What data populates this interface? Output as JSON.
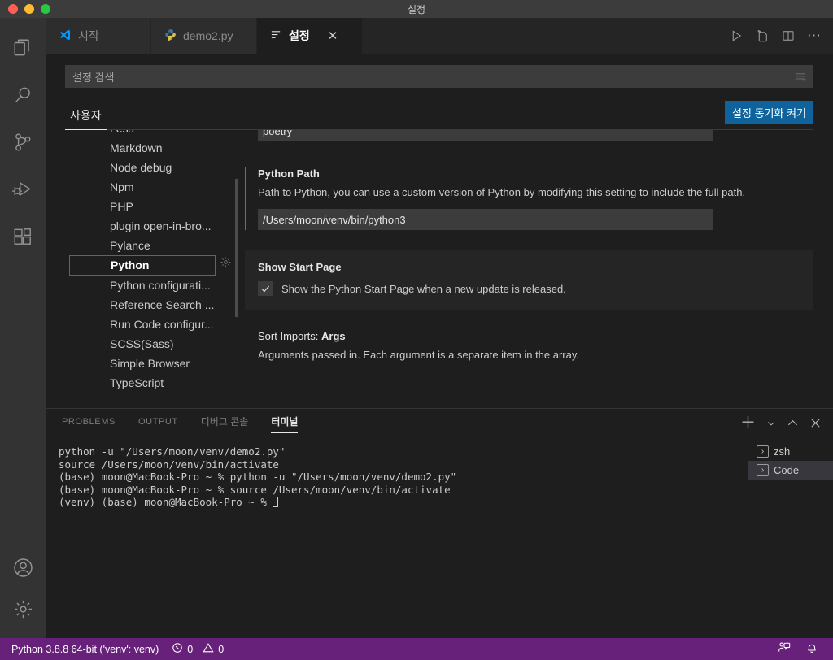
{
  "window": {
    "title": "설정",
    "traffic_lights": [
      "close",
      "minimize",
      "zoom"
    ]
  },
  "activity_bar": {
    "items": [
      {
        "name": "explorer",
        "icon": "files-icon"
      },
      {
        "name": "search",
        "icon": "search-icon"
      },
      {
        "name": "source-control",
        "icon": "source-control-icon"
      },
      {
        "name": "run-and-debug",
        "icon": "run-debug-icon"
      },
      {
        "name": "extensions",
        "icon": "extensions-icon"
      }
    ],
    "bottom_items": [
      {
        "name": "accounts",
        "icon": "account-icon"
      },
      {
        "name": "manage",
        "icon": "gear-icon"
      }
    ]
  },
  "tabs": [
    {
      "label": "시작",
      "icon": "vscode-logo-icon",
      "active": false,
      "closable": false
    },
    {
      "label": "demo2.py",
      "icon": "python-logo-icon",
      "active": false,
      "closable": false
    },
    {
      "label": "설정",
      "icon": "settings-lines-icon",
      "active": true,
      "closable": true,
      "close_label": "✕"
    }
  ],
  "editor_actions": [
    {
      "name": "run-python-file",
      "icon": "play-icon"
    },
    {
      "name": "run-python-file-in-terminal",
      "icon": "run-file-icon"
    },
    {
      "name": "split-editor",
      "icon": "split-editor-icon"
    },
    {
      "name": "more-actions",
      "icon": "ellipsis-icon",
      "label": "⋯"
    }
  ],
  "settings": {
    "search": {
      "placeholder": "설정 검색",
      "value": "",
      "filter_icon": "filter-icon"
    },
    "scope_tabs": [
      {
        "label": "사용자",
        "active": true
      }
    ],
    "sync_button": {
      "label": "설정 동기화 켜기",
      "color": "#0e639c"
    },
    "toc": {
      "items": [
        {
          "label": "Less",
          "partial": true,
          "selected": false
        },
        {
          "label": "Markdown",
          "selected": false
        },
        {
          "label": "Node debug",
          "selected": false
        },
        {
          "label": "Npm",
          "selected": false
        },
        {
          "label": "PHP",
          "selected": false
        },
        {
          "label": "plugin open-in-bro...",
          "selected": false
        },
        {
          "label": "Pylance",
          "selected": false
        },
        {
          "label": "Python",
          "selected": true
        },
        {
          "label": "Python configurati...",
          "selected": false
        },
        {
          "label": "Reference Search ...",
          "selected": false
        },
        {
          "label": "Run Code configur...",
          "selected": false
        },
        {
          "label": "SCSS(Sass)",
          "selected": false
        },
        {
          "label": "Simple Browser",
          "selected": false
        },
        {
          "label": "TypeScript",
          "selected": false
        }
      ]
    },
    "entries": {
      "poetry": {
        "value": "poetry"
      },
      "python_path": {
        "title": "Python Path",
        "description": "Path to Python, you can use a custom version of Python by modifying this setting to include the full path.",
        "value": "/Users/moon/venv/bin/python3",
        "modified": true
      },
      "show_start_page": {
        "title": "Show Start Page",
        "checkbox_label": "Show the Python Start Page when a new update is released.",
        "checked": true,
        "gear_icon": "gear-icon"
      },
      "sort_imports_args": {
        "title_prefix": "Sort Imports: ",
        "title_bold": "Args",
        "description": "Arguments passed in. Each argument is a separate item in the array."
      }
    }
  },
  "panel": {
    "tabs": [
      {
        "label": "PROBLEMS",
        "active": false,
        "korean": false
      },
      {
        "label": "OUTPUT",
        "active": false,
        "korean": false
      },
      {
        "label": "디버그 콘솔",
        "active": false,
        "korean": true
      },
      {
        "label": "터미널",
        "active": true,
        "korean": true
      }
    ],
    "actions": [
      {
        "name": "new-terminal",
        "icon": "plus-icon",
        "label": "＋"
      },
      {
        "name": "terminal-dropdown",
        "icon": "chevron-down-icon"
      },
      {
        "name": "maximize-panel",
        "icon": "chevron-up-icon"
      },
      {
        "name": "close-panel",
        "icon": "close-icon"
      }
    ],
    "terminal": {
      "lines": [
        "python -u \"/Users/moon/venv/demo2.py\"",
        "source /Users/moon/venv/bin/activate",
        "(base) moon@MacBook-Pro ~ % python -u \"/Users/moon/venv/demo2.py\"",
        "(base) moon@MacBook-Pro ~ % source /Users/moon/venv/bin/activate",
        "(venv) (base) moon@MacBook-Pro ~ % "
      ]
    },
    "terminal_list": [
      {
        "label": "zsh",
        "selected": false,
        "icon": "terminal-icon"
      },
      {
        "label": "Code",
        "selected": true,
        "icon": "terminal-icon"
      }
    ]
  },
  "status_bar": {
    "background": "#68217a",
    "python_interpreter": "Python 3.8.8 64-bit ('venv': venv)",
    "errors": "0",
    "warnings": "0",
    "error_icon": "error-circle-icon",
    "warning_icon": "warning-triangle-icon",
    "right_items": [
      {
        "name": "feedback",
        "icon": "feedback-person-icon"
      },
      {
        "name": "notifications",
        "icon": "bell-icon"
      }
    ]
  }
}
